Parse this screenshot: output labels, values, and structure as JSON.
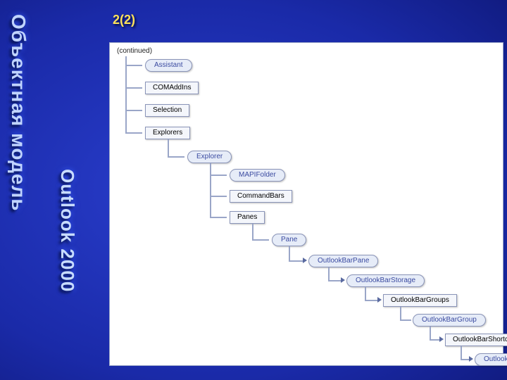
{
  "sidebar": {
    "title_primary": "Объектная модель",
    "title_secondary": "Outlook 2000"
  },
  "page_number": "2(2)",
  "panel": {
    "continued_label": "(continued)"
  },
  "tree": {
    "root_children": [
      {
        "kind": "oval",
        "label": "Assistant"
      },
      {
        "kind": "box",
        "label": "COMAddIns"
      },
      {
        "kind": "box",
        "label": "Selection"
      },
      {
        "kind": "box",
        "label": "Explorers"
      }
    ],
    "explorer": {
      "label": "Explorer",
      "children": [
        {
          "kind": "oval",
          "label": "MAPIFolder"
        },
        {
          "kind": "box",
          "label": "CommandBars"
        },
        {
          "kind": "box",
          "label": "Panes"
        }
      ]
    },
    "pane": {
      "label": "Pane",
      "children": [
        {
          "kind": "oval",
          "label": "OutlookBarPane"
        }
      ]
    },
    "storage": {
      "label": "OutlookBarStorage"
    },
    "groups": {
      "label": "OutlookBarGroups"
    },
    "group": {
      "label": "OutlookBarGroup"
    },
    "shortcuts": {
      "label": "OutlookBarShortcuts"
    },
    "shortcut": {
      "label": "OutlookBarShortcut"
    }
  }
}
